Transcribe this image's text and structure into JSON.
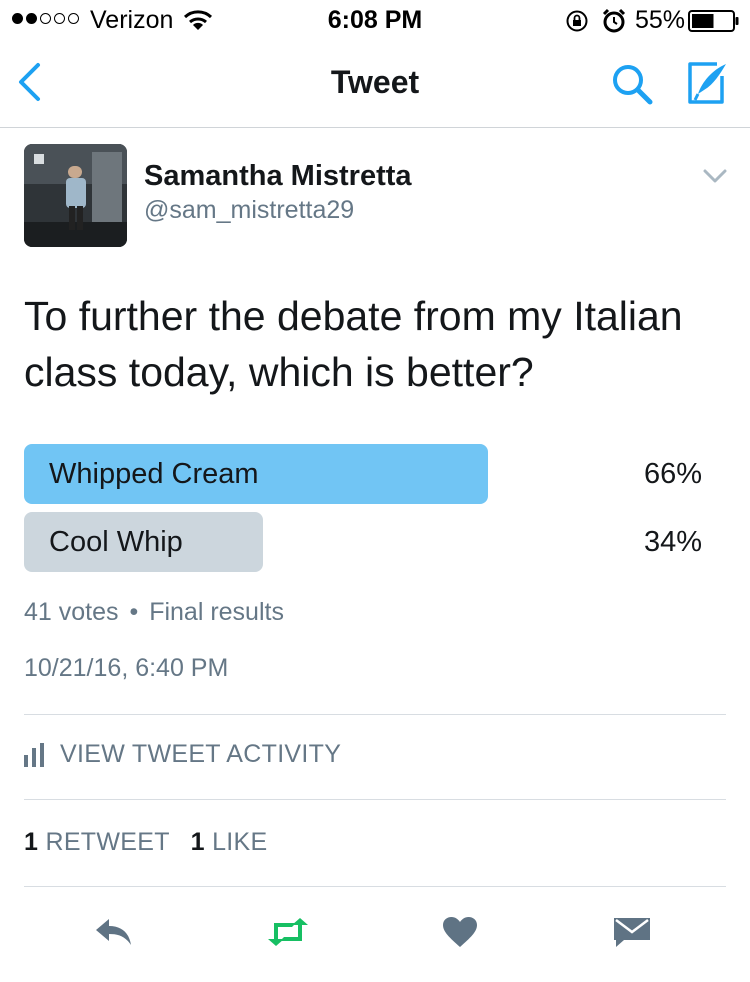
{
  "status_bar": {
    "carrier": "Verizon",
    "time": "6:08 PM",
    "battery": "55%",
    "signal_bars_filled": 2,
    "signal_bars_total": 5,
    "battery_level": 0.55
  },
  "nav": {
    "title": "Tweet",
    "accent_color": "#1da1f2"
  },
  "tweet": {
    "author_name": "Samantha Mistretta",
    "author_handle": "@sam_mistretta29",
    "text": "To further the debate from my Italian class today, which is better?",
    "timestamp": "10/21/16, 6:40 PM"
  },
  "poll": {
    "options": [
      {
        "label": "Whipped Cream",
        "percent": "66%",
        "value": 0.66,
        "winner": true,
        "color": "#71c5f4"
      },
      {
        "label": "Cool Whip",
        "percent": "34%",
        "value": 0.34,
        "winner": false,
        "color": "#ccd6dd"
      }
    ],
    "votes": "41 votes",
    "separator": "•",
    "status": "Final results"
  },
  "activity": {
    "label": "VIEW TWEET ACTIVITY"
  },
  "stats": {
    "retweet_count": "1",
    "retweet_label": "RETWEET",
    "like_count": "1",
    "like_label": "LIKE"
  },
  "actions": {
    "retweet_color": "#17bf63",
    "icon_color": "#5f7384"
  }
}
